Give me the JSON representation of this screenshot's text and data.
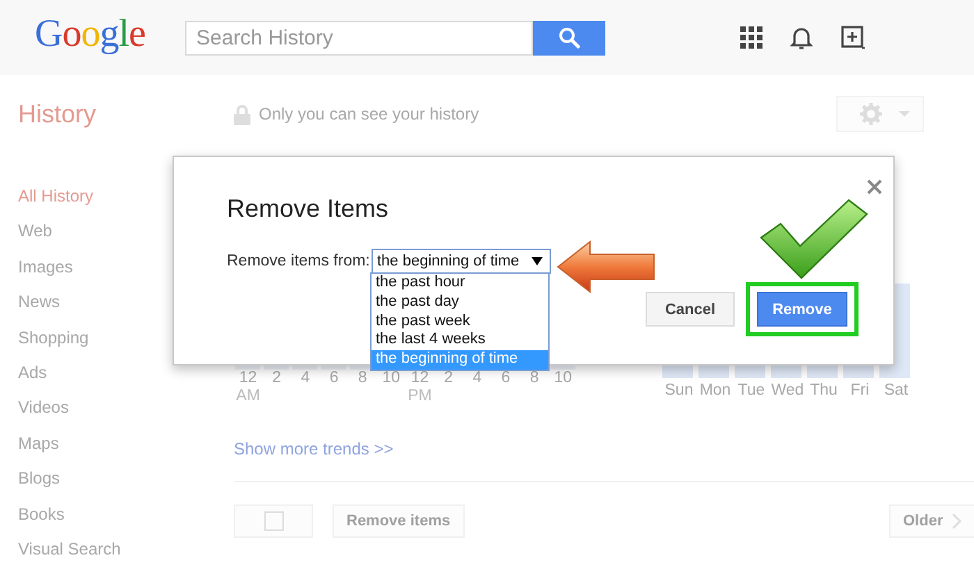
{
  "header": {
    "logo": "Google",
    "search": {
      "placeholder": "Search History"
    }
  },
  "page": {
    "title": "History",
    "privacy_note": "Only you can see your history"
  },
  "sidebar": {
    "items": [
      {
        "label": "All History",
        "selected": true
      },
      {
        "label": "Web",
        "selected": false
      },
      {
        "label": "Images",
        "selected": false
      },
      {
        "label": "News",
        "selected": false
      },
      {
        "label": "Shopping",
        "selected": false
      },
      {
        "label": "Ads",
        "selected": false
      },
      {
        "label": "Videos",
        "selected": false
      },
      {
        "label": "Maps",
        "selected": false
      },
      {
        "label": "Blogs",
        "selected": false
      },
      {
        "label": "Books",
        "selected": false
      },
      {
        "label": "Visual Search",
        "selected": false
      }
    ]
  },
  "trends": {
    "hours": [
      {
        "label": "12",
        "period": "AM"
      },
      {
        "label": "2"
      },
      {
        "label": "4"
      },
      {
        "label": "6"
      },
      {
        "label": "8"
      },
      {
        "label": "10"
      },
      {
        "label": "12",
        "period": "PM"
      },
      {
        "label": "2"
      },
      {
        "label": "4"
      },
      {
        "label": "6"
      },
      {
        "label": "8"
      },
      {
        "label": "10"
      }
    ],
    "days": [
      "Sun",
      "Mon",
      "Tue",
      "Wed",
      "Thu",
      "Fri",
      "Sat"
    ],
    "more_link": "Show more trends >>"
  },
  "actions": {
    "select_all": {
      "checked": false
    },
    "remove_button": "Remove items",
    "older_button": "Older"
  },
  "dialog": {
    "title": "Remove Items",
    "field_label": "Remove items from:",
    "select_value": "the beginning of time",
    "options": [
      {
        "label": "the past hour",
        "selected": false
      },
      {
        "label": "the past day",
        "selected": false
      },
      {
        "label": "the past week",
        "selected": false
      },
      {
        "label": "the last 4 weeks",
        "selected": false
      },
      {
        "label": "the beginning of time",
        "selected": true
      }
    ],
    "buttons": {
      "cancel": "Cancel",
      "remove": "Remove"
    }
  }
}
